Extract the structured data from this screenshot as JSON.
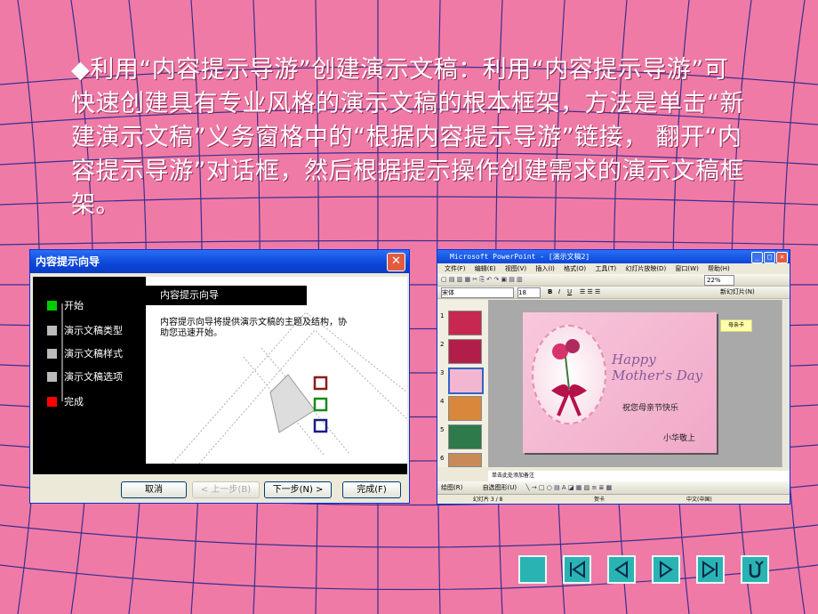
{
  "paragraph": "◆利用“内容提示导游”创建演示文稿：利用“内容提示导游”可快速创建具有专业风格的演示文稿的根本框架，方法是单击“新建演示文稿”义务窗格中的“根据内容提示导游”链接， 翻开“内容提示导游”对话框，然后根据提示操作创建需求的演示文稿框架。",
  "wizard": {
    "title": "内容提示向导",
    "steps": [
      "开始",
      "演示文稿类型",
      "演示文稿样式",
      "演示文稿选项",
      "完成"
    ],
    "header": "内容提示向导",
    "description": "内容提示向导将提供演示文稿的主题及结构，协助您迅速开始。",
    "buttons": {
      "cancel": "取消",
      "back": "< 上一步(B)",
      "next": "下一步(N) >",
      "finish": "完成(F)"
    }
  },
  "ppt": {
    "title": "Microsoft PowerPoint - [演示文稿2]",
    "menus": [
      "文件(F)",
      "编辑(E)",
      "视图(V)",
      "插入(I)",
      "格式(O)",
      "工具(T)",
      "幻灯片放映(D)",
      "窗口(W)",
      "帮助(H)"
    ],
    "font_name": "宋体",
    "font_size": "18",
    "zoom": "22%",
    "new_slide": "新幻灯片(N)",
    "thumb_numbers": [
      "1",
      "2",
      "3",
      "4",
      "5",
      "6"
    ],
    "slide_script": "Happy Mother's Day",
    "slide_greeting": "祝您母亲节快乐",
    "slide_signature": "小华敬上",
    "comment": "母亲卡",
    "notes_placeholder": "单击此处添加备注",
    "draw_label": "绘图(R)",
    "autoshapes": "自选图形(U)",
    "status_slide": "幻灯片 3 / 8",
    "status_design": "贺卡",
    "status_lang": "中文(中国)"
  },
  "colors": {
    "background": "#f07aa6",
    "nav_button": "#2ab3b3",
    "step_current": "#00cc00",
    "step_done": "#ff0000"
  },
  "nav_icons": [
    "home-square-icon",
    "first-slide-icon",
    "previous-slide-icon",
    "next-slide-icon",
    "last-slide-icon",
    "return-icon"
  ]
}
